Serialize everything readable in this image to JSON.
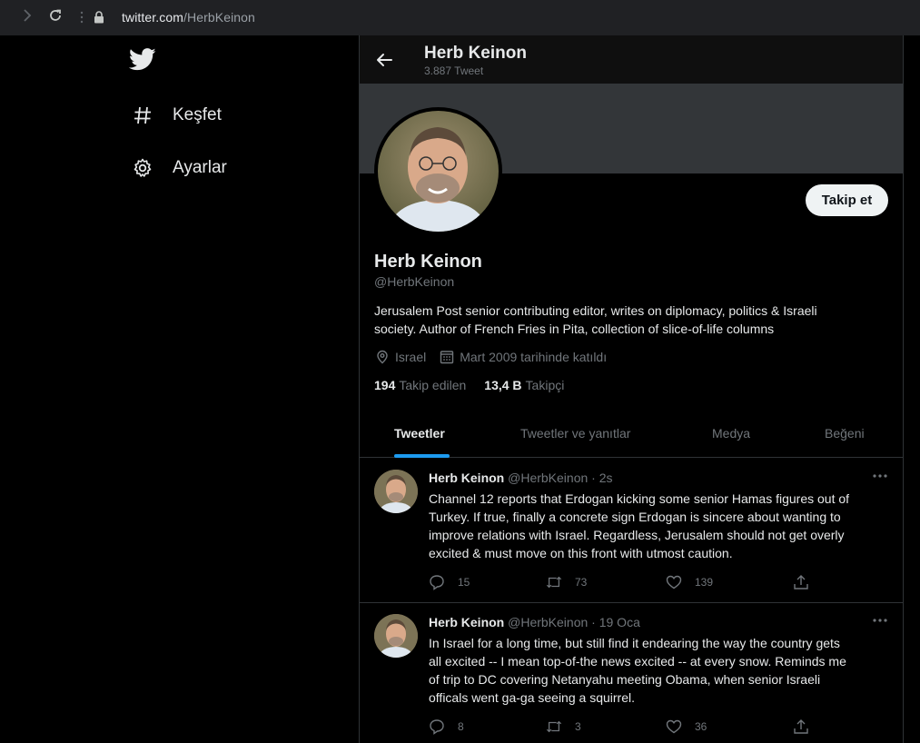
{
  "browser": {
    "url_host": "twitter.com",
    "url_path": "/HerbKeinon"
  },
  "sidebar": {
    "items": [
      {
        "label": "Keşfet",
        "icon": "hashtag-icon"
      },
      {
        "label": "Ayarlar",
        "icon": "gear-icon"
      }
    ]
  },
  "header": {
    "name": "Herb Keinon",
    "tweet_count": "3.887 Tweet"
  },
  "profile": {
    "name": "Herb Keinon",
    "handle": "@HerbKeinon",
    "bio_line1": "Jerusalem Post senior contributing editor, writes on diplomacy, politics & Israeli",
    "bio_line2": "society. Author of  French Fries in Pita, collection of slice-of-life columns",
    "location": "Israel",
    "joined": "Mart 2009 tarihinde katıldı",
    "following_count": "194",
    "following_label": "Takip edilen",
    "followers_count": "13,4 B",
    "followers_label": "Takipçi",
    "follow_button": "Takip et"
  },
  "tabs": [
    {
      "label": "Tweetler",
      "active": true
    },
    {
      "label": "Tweetler ve yanıtlar",
      "active": false
    },
    {
      "label": "Medya",
      "active": false
    },
    {
      "label": "Beğeni",
      "active": false
    }
  ],
  "tweets": [
    {
      "name": "Herb Keinon",
      "handle_time": "@HerbKeinon · 2s",
      "lines": [
        "Channel 12 reports that Erdogan kicking some senior Hamas figures out of",
        "Turkey. If true, finally a concrete sign Erdogan is sincere about wanting to",
        "improve relations with Israel. Regardless, Jerusalem should not get overly",
        "excited & must move on this front with utmost caution."
      ],
      "replies": "15",
      "retweets": "73",
      "likes": "139"
    },
    {
      "name": "Herb Keinon",
      "handle_time": "@HerbKeinon · 19 Oca",
      "lines": [
        "In Israel for a long time, but still find it endearing the way the country gets",
        "all excited -- I mean top-of-the news excited -- at every snow. Reminds me",
        "of trip to DC covering Netanyahu meeting Obama, when senior Israeli",
        "officals went ga-ga seeing a squirrel."
      ],
      "replies": "8",
      "retweets": "3",
      "likes": "36"
    }
  ],
  "colors": {
    "accent": "#1d9bf0",
    "background": "#000000",
    "muted_text": "#71767b",
    "border": "#2f3336"
  }
}
